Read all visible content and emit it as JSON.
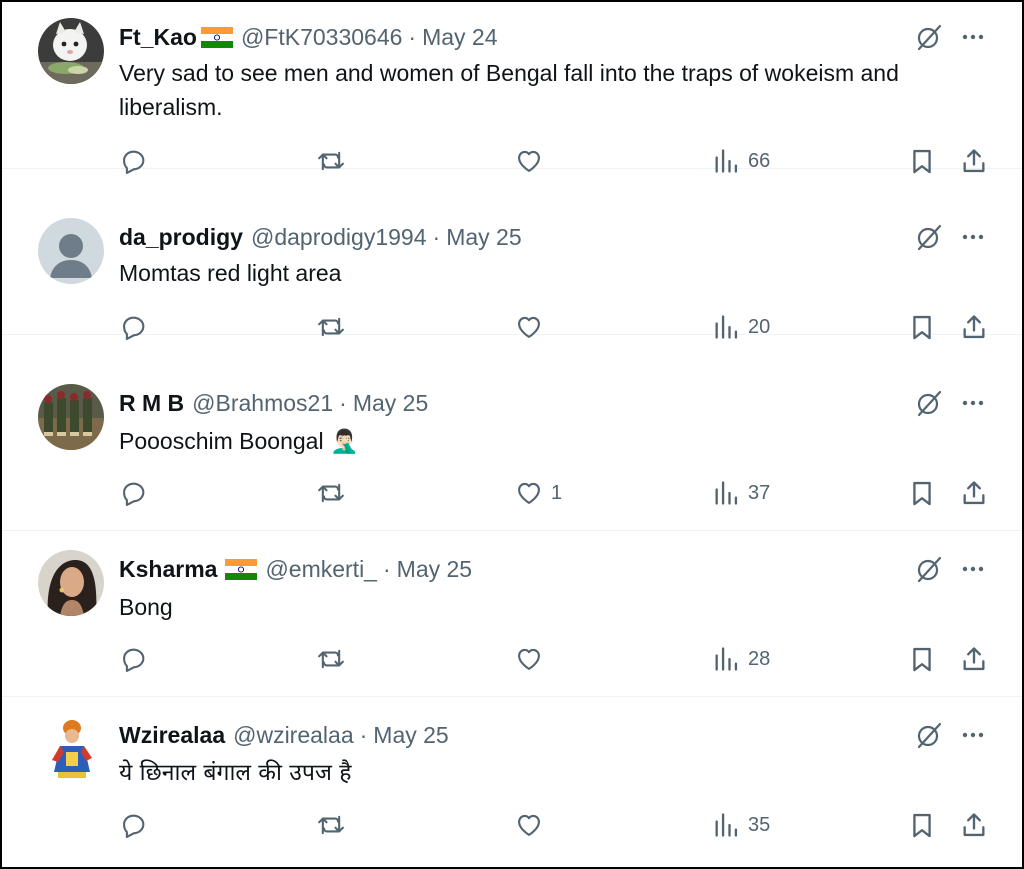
{
  "tweets": [
    {
      "name": "Ft_Kao",
      "flag": "india-flag",
      "handle": "@FtK70330646",
      "sep": "·",
      "date": "May 24",
      "text": "Very sad to see men and women of Bengal fall into the traps of wokeism and liberalism.",
      "replies": "",
      "reposts": "",
      "likes": "",
      "views": "66",
      "avatar": "cat-photo"
    },
    {
      "name": "da_prodigy",
      "flag": "",
      "handle": "@daprodigy1994",
      "sep": "·",
      "date": "May 25",
      "text": "Momtas red light area",
      "replies": "",
      "reposts": "",
      "likes": "",
      "views": "20",
      "avatar": "default-profile"
    },
    {
      "name": "R M B",
      "flag": "",
      "handle": "@Brahmos21",
      "sep": "·",
      "date": "May 25",
      "text": "Poooschim Boongal 🤦🏻‍♂️",
      "replies": "",
      "reposts": "",
      "likes": "1",
      "views": "37",
      "avatar": "soldiers-photo"
    },
    {
      "name": "Ksharma",
      "flag": "india-flag",
      "handle": "@emkerti_",
      "sep": "·",
      "date": "May 25",
      "text": "Bong",
      "replies": "",
      "reposts": "",
      "likes": "",
      "views": "28",
      "avatar": "woman-photo"
    },
    {
      "name": "Wzirealaa",
      "flag": "",
      "handle": "@wzirealaa",
      "sep": "·",
      "date": "May 25",
      "text": "ये छिनाल बंगाल की उपज है",
      "replies": "",
      "reposts": "",
      "likes": "",
      "views": "35",
      "avatar": "cartoon-figure"
    }
  ],
  "colors": {
    "text": "#0f1419",
    "muted": "#536471",
    "divider": "#eff3f4"
  }
}
